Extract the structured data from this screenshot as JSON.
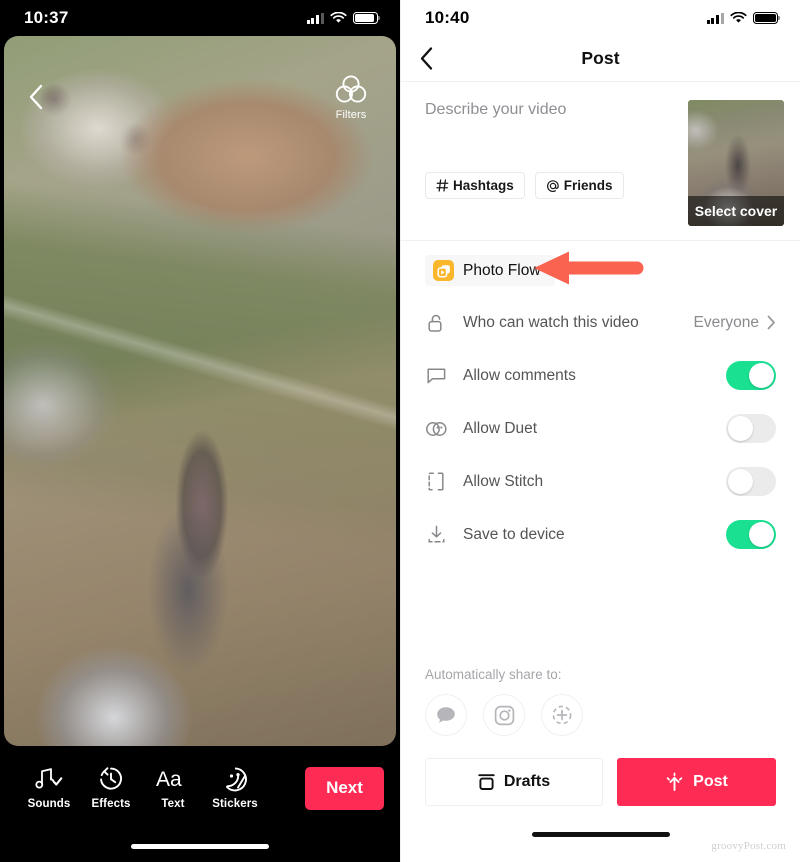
{
  "left_phone": {
    "statusbar": {
      "time": "10:37",
      "signal_icon": "cellular-bars-icon",
      "wifi_icon": "wifi-icon",
      "battery_icon": "battery-icon"
    },
    "preview": {
      "back_icon": "chevron-left-icon",
      "filters_label": "Filters",
      "filters_icon": "filters-venn-icon",
      "media_alt": "Dog lying on a green couch cushion"
    },
    "toolbar": {
      "tools": [
        {
          "label": "Sounds",
          "icon": "music-note-check-icon"
        },
        {
          "label": "Effects",
          "icon": "timer-effects-icon"
        },
        {
          "label": "Text",
          "icon": "text-aa-icon"
        },
        {
          "label": "Stickers",
          "icon": "sticker-smiley-icon"
        }
      ],
      "next_label": "Next",
      "next_color": "#FE2C55"
    }
  },
  "right_phone": {
    "statusbar": {
      "time": "10:40",
      "signal_icon": "cellular-bars-icon",
      "wifi_icon": "wifi-icon",
      "battery_icon": "battery-icon"
    },
    "navbar": {
      "back_icon": "chevron-left-icon",
      "title": "Post"
    },
    "compose": {
      "description_placeholder": "Describe your video",
      "description_value": "",
      "hashtags_label": "Hashtags",
      "hashtags_icon": "hash-icon",
      "friends_label": "Friends",
      "friends_icon": "at-icon",
      "cover_label": "Select cover",
      "cover_alt": "Dog looking at the camera"
    },
    "photo_flow": {
      "label": "Photo Flow",
      "icon": "photo-flow-icon",
      "icon_color": "#FBB72C",
      "annotation_arrow_color": "#F9634F"
    },
    "settings": [
      {
        "label": "Who can watch this video",
        "icon": "lock-open-icon",
        "type": "value",
        "value": "Everyone",
        "chevron": "chevron-right-icon"
      },
      {
        "label": "Allow comments",
        "icon": "comment-icon",
        "type": "toggle",
        "state": "on"
      },
      {
        "label": "Allow Duet",
        "icon": "duet-icon",
        "type": "toggle",
        "state": "off"
      },
      {
        "label": "Allow Stitch",
        "icon": "stitch-icon",
        "type": "toggle",
        "state": "off"
      },
      {
        "label": "Save to device",
        "icon": "download-icon",
        "type": "toggle",
        "state": "on"
      }
    ],
    "toggle_on_color": "#1AE091",
    "toggle_off_color": "#EBEBEC",
    "share": {
      "title": "Automatically share to:",
      "options": [
        {
          "icon": "message-bubble-icon"
        },
        {
          "icon": "instagram-icon"
        },
        {
          "icon": "add-more-icon"
        }
      ]
    },
    "actions": {
      "drafts_label": "Drafts",
      "drafts_icon": "drafts-archive-icon",
      "post_label": "Post",
      "post_icon": "post-sparkle-icon",
      "post_color": "#FE2C55"
    },
    "watermark": "groovyPost.com"
  }
}
